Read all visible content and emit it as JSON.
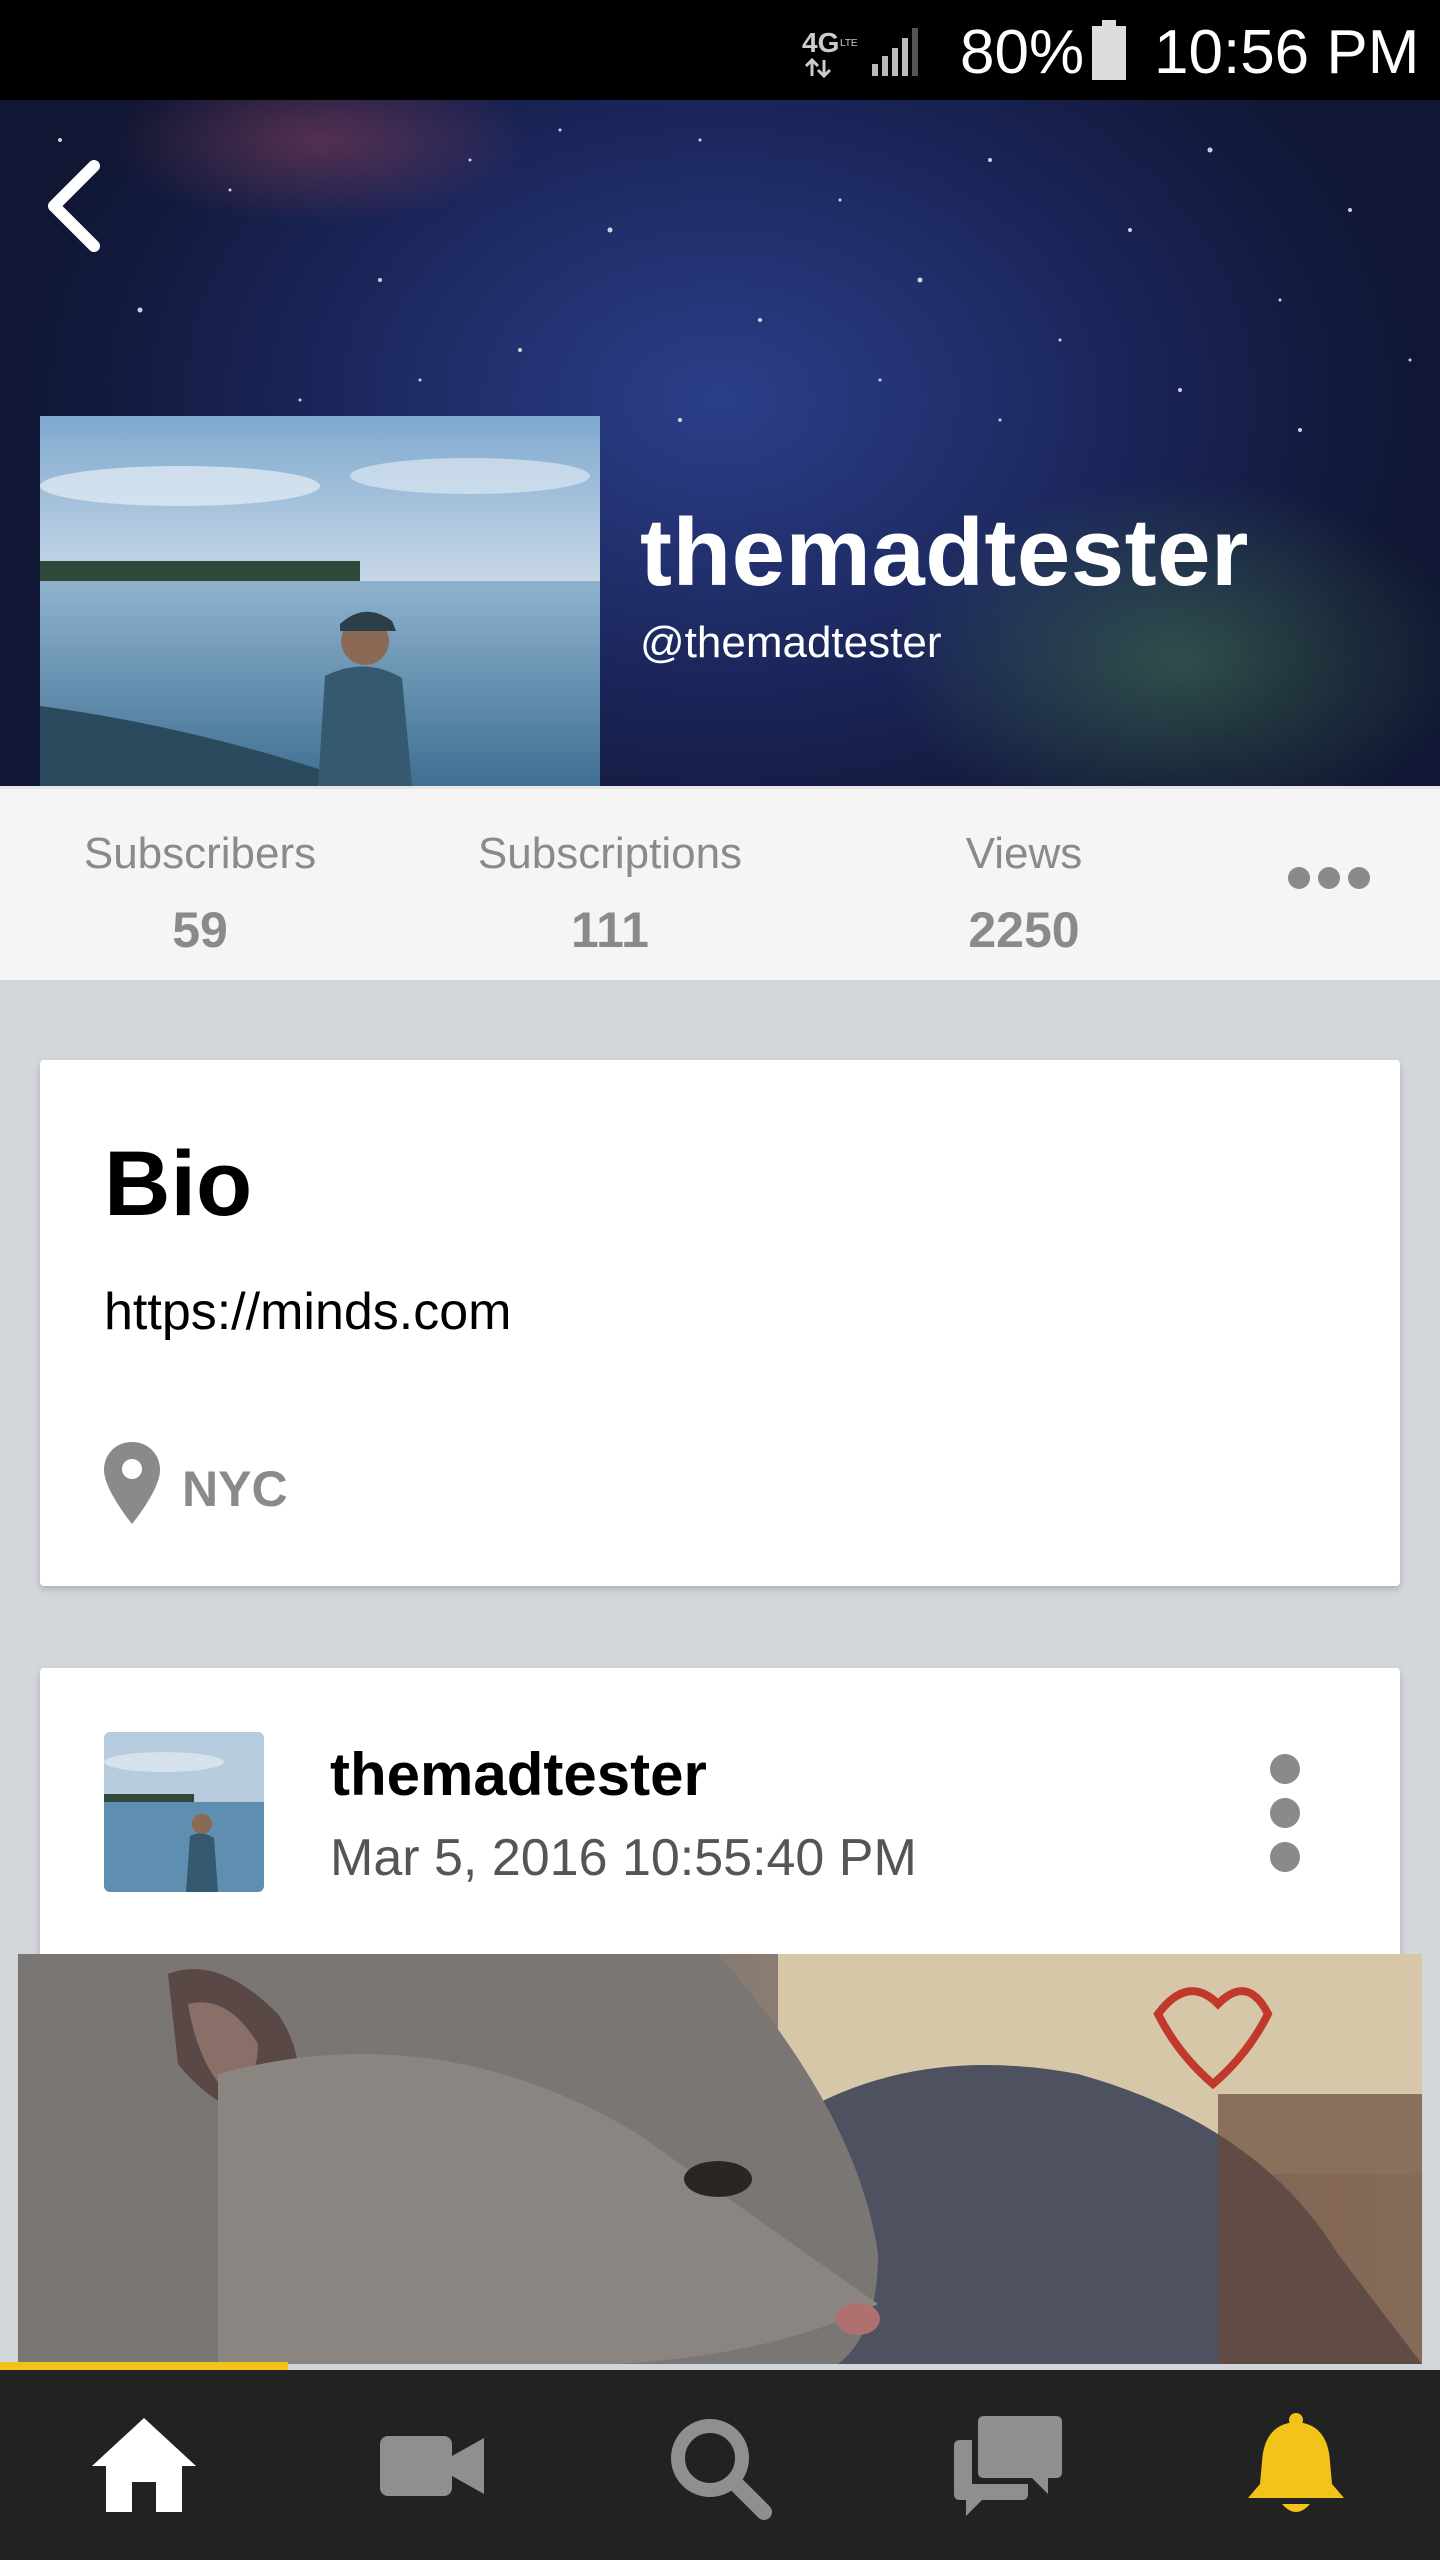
{
  "status_bar": {
    "network": "4G LTE",
    "network_icon": "network-4g-icon",
    "signal_icon": "signal-icon",
    "battery_percent": "80%",
    "battery_icon": "battery-icon",
    "time": "10:56 PM"
  },
  "header": {
    "back_icon": "chevron-left-icon",
    "name": "themadtester",
    "handle": "@themadtester"
  },
  "stats": {
    "subscribers_label": "Subscribers",
    "subscribers_value": "59",
    "subscriptions_label": "Subscriptions",
    "subscriptions_value": "111",
    "views_label": "Views",
    "views_value": "2250",
    "more_icon": "more-horizontal-icon"
  },
  "bio": {
    "title": "Bio",
    "link": "https://minds.com",
    "location_icon": "map-pin-icon",
    "location": "NYC"
  },
  "post": {
    "author": "themadtester",
    "timestamp": "Mar 5, 2016 10:55:40 PM",
    "menu_icon": "more-vertical-icon"
  },
  "bottom_nav": {
    "items": [
      {
        "icon": "home-icon",
        "active": true
      },
      {
        "icon": "video-camera-icon",
        "active": false
      },
      {
        "icon": "search-icon",
        "active": false
      },
      {
        "icon": "chat-icon",
        "active": false
      },
      {
        "icon": "bell-icon",
        "active": false
      }
    ],
    "progress_fraction": 0.2
  },
  "colors": {
    "accent": "#f2c318",
    "nav_background": "#222222",
    "muted_text": "#8a8a8a",
    "page_background": "#d2d5da"
  }
}
